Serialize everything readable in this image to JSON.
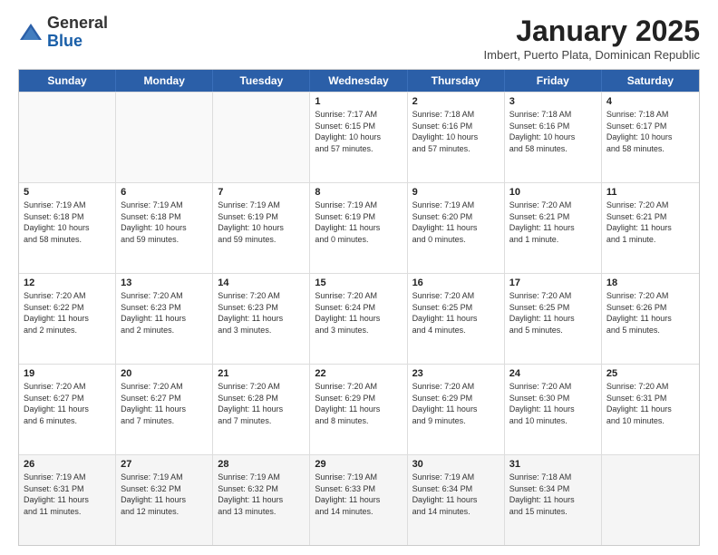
{
  "header": {
    "logo_general": "General",
    "logo_blue": "Blue",
    "month_title": "January 2025",
    "subtitle": "Imbert, Puerto Plata, Dominican Republic"
  },
  "weekdays": [
    "Sunday",
    "Monday",
    "Tuesday",
    "Wednesday",
    "Thursday",
    "Friday",
    "Saturday"
  ],
  "rows": [
    [
      {
        "day": "",
        "info": ""
      },
      {
        "day": "",
        "info": ""
      },
      {
        "day": "",
        "info": ""
      },
      {
        "day": "1",
        "info": "Sunrise: 7:17 AM\nSunset: 6:15 PM\nDaylight: 10 hours\nand 57 minutes."
      },
      {
        "day": "2",
        "info": "Sunrise: 7:18 AM\nSunset: 6:16 PM\nDaylight: 10 hours\nand 57 minutes."
      },
      {
        "day": "3",
        "info": "Sunrise: 7:18 AM\nSunset: 6:16 PM\nDaylight: 10 hours\nand 58 minutes."
      },
      {
        "day": "4",
        "info": "Sunrise: 7:18 AM\nSunset: 6:17 PM\nDaylight: 10 hours\nand 58 minutes."
      }
    ],
    [
      {
        "day": "5",
        "info": "Sunrise: 7:19 AM\nSunset: 6:18 PM\nDaylight: 10 hours\nand 58 minutes."
      },
      {
        "day": "6",
        "info": "Sunrise: 7:19 AM\nSunset: 6:18 PM\nDaylight: 10 hours\nand 59 minutes."
      },
      {
        "day": "7",
        "info": "Sunrise: 7:19 AM\nSunset: 6:19 PM\nDaylight: 10 hours\nand 59 minutes."
      },
      {
        "day": "8",
        "info": "Sunrise: 7:19 AM\nSunset: 6:19 PM\nDaylight: 11 hours\nand 0 minutes."
      },
      {
        "day": "9",
        "info": "Sunrise: 7:19 AM\nSunset: 6:20 PM\nDaylight: 11 hours\nand 0 minutes."
      },
      {
        "day": "10",
        "info": "Sunrise: 7:20 AM\nSunset: 6:21 PM\nDaylight: 11 hours\nand 1 minute."
      },
      {
        "day": "11",
        "info": "Sunrise: 7:20 AM\nSunset: 6:21 PM\nDaylight: 11 hours\nand 1 minute."
      }
    ],
    [
      {
        "day": "12",
        "info": "Sunrise: 7:20 AM\nSunset: 6:22 PM\nDaylight: 11 hours\nand 2 minutes."
      },
      {
        "day": "13",
        "info": "Sunrise: 7:20 AM\nSunset: 6:23 PM\nDaylight: 11 hours\nand 2 minutes."
      },
      {
        "day": "14",
        "info": "Sunrise: 7:20 AM\nSunset: 6:23 PM\nDaylight: 11 hours\nand 3 minutes."
      },
      {
        "day": "15",
        "info": "Sunrise: 7:20 AM\nSunset: 6:24 PM\nDaylight: 11 hours\nand 3 minutes."
      },
      {
        "day": "16",
        "info": "Sunrise: 7:20 AM\nSunset: 6:25 PM\nDaylight: 11 hours\nand 4 minutes."
      },
      {
        "day": "17",
        "info": "Sunrise: 7:20 AM\nSunset: 6:25 PM\nDaylight: 11 hours\nand 5 minutes."
      },
      {
        "day": "18",
        "info": "Sunrise: 7:20 AM\nSunset: 6:26 PM\nDaylight: 11 hours\nand 5 minutes."
      }
    ],
    [
      {
        "day": "19",
        "info": "Sunrise: 7:20 AM\nSunset: 6:27 PM\nDaylight: 11 hours\nand 6 minutes."
      },
      {
        "day": "20",
        "info": "Sunrise: 7:20 AM\nSunset: 6:27 PM\nDaylight: 11 hours\nand 7 minutes."
      },
      {
        "day": "21",
        "info": "Sunrise: 7:20 AM\nSunset: 6:28 PM\nDaylight: 11 hours\nand 7 minutes."
      },
      {
        "day": "22",
        "info": "Sunrise: 7:20 AM\nSunset: 6:29 PM\nDaylight: 11 hours\nand 8 minutes."
      },
      {
        "day": "23",
        "info": "Sunrise: 7:20 AM\nSunset: 6:29 PM\nDaylight: 11 hours\nand 9 minutes."
      },
      {
        "day": "24",
        "info": "Sunrise: 7:20 AM\nSunset: 6:30 PM\nDaylight: 11 hours\nand 10 minutes."
      },
      {
        "day": "25",
        "info": "Sunrise: 7:20 AM\nSunset: 6:31 PM\nDaylight: 11 hours\nand 10 minutes."
      }
    ],
    [
      {
        "day": "26",
        "info": "Sunrise: 7:19 AM\nSunset: 6:31 PM\nDaylight: 11 hours\nand 11 minutes."
      },
      {
        "day": "27",
        "info": "Sunrise: 7:19 AM\nSunset: 6:32 PM\nDaylight: 11 hours\nand 12 minutes."
      },
      {
        "day": "28",
        "info": "Sunrise: 7:19 AM\nSunset: 6:32 PM\nDaylight: 11 hours\nand 13 minutes."
      },
      {
        "day": "29",
        "info": "Sunrise: 7:19 AM\nSunset: 6:33 PM\nDaylight: 11 hours\nand 14 minutes."
      },
      {
        "day": "30",
        "info": "Sunrise: 7:19 AM\nSunset: 6:34 PM\nDaylight: 11 hours\nand 14 minutes."
      },
      {
        "day": "31",
        "info": "Sunrise: 7:18 AM\nSunset: 6:34 PM\nDaylight: 11 hours\nand 15 minutes."
      },
      {
        "day": "",
        "info": ""
      }
    ]
  ]
}
